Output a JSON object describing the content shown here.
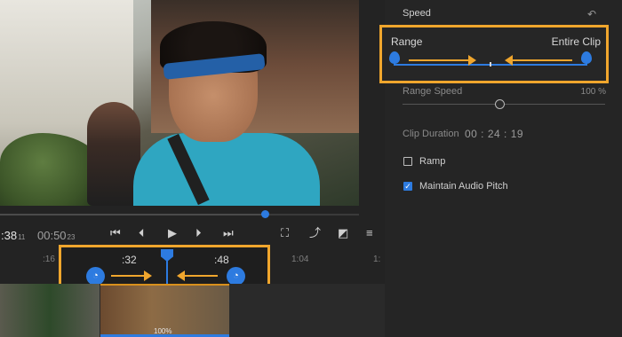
{
  "colors": {
    "accent": "#2d7be0",
    "highlight": "#f0a62d",
    "panel": "#252525",
    "background": "#1b1b1b"
  },
  "monitor": {
    "timecode_current": ":38",
    "timecode_current_frames": "11",
    "timecode_total": "00:50",
    "timecode_total_frames": "23",
    "controls": [
      {
        "name": "skip-back-icon",
        "glyph": "⏮"
      },
      {
        "name": "step-back-icon",
        "glyph": "⏴"
      },
      {
        "name": "play-icon",
        "glyph": "▶"
      },
      {
        "name": "step-forward-icon",
        "glyph": "⏵"
      },
      {
        "name": "skip-forward-icon",
        "glyph": "⏭"
      },
      {
        "name": "fit-icon",
        "glyph": "⛶"
      },
      {
        "name": "export-frame-icon",
        "glyph": "⤴"
      },
      {
        "name": "overlay-icon",
        "glyph": "◩"
      },
      {
        "name": "menu-icon",
        "glyph": "≡"
      }
    ]
  },
  "timeline": {
    "ruler_ticks": [
      ":16",
      ":32",
      ":48",
      "1:04",
      "1:"
    ],
    "range_start_label": ":32",
    "range_end_label": ":48",
    "clip_speed_label": "100%"
  },
  "panel": {
    "title": "Speed",
    "reset_icon": "↶",
    "range_label": "Range",
    "entire_clip_label": "Entire Clip",
    "range_speed_label": "Range Speed",
    "range_speed_value": "100 %",
    "clip_duration_label": "Clip Duration",
    "clip_duration_value": "00 : 24 : 19",
    "ramp_label": "Ramp",
    "ramp_checked": false,
    "maintain_pitch_label": "Maintain Audio Pitch",
    "maintain_pitch_checked": true,
    "checkmark": "✓"
  }
}
